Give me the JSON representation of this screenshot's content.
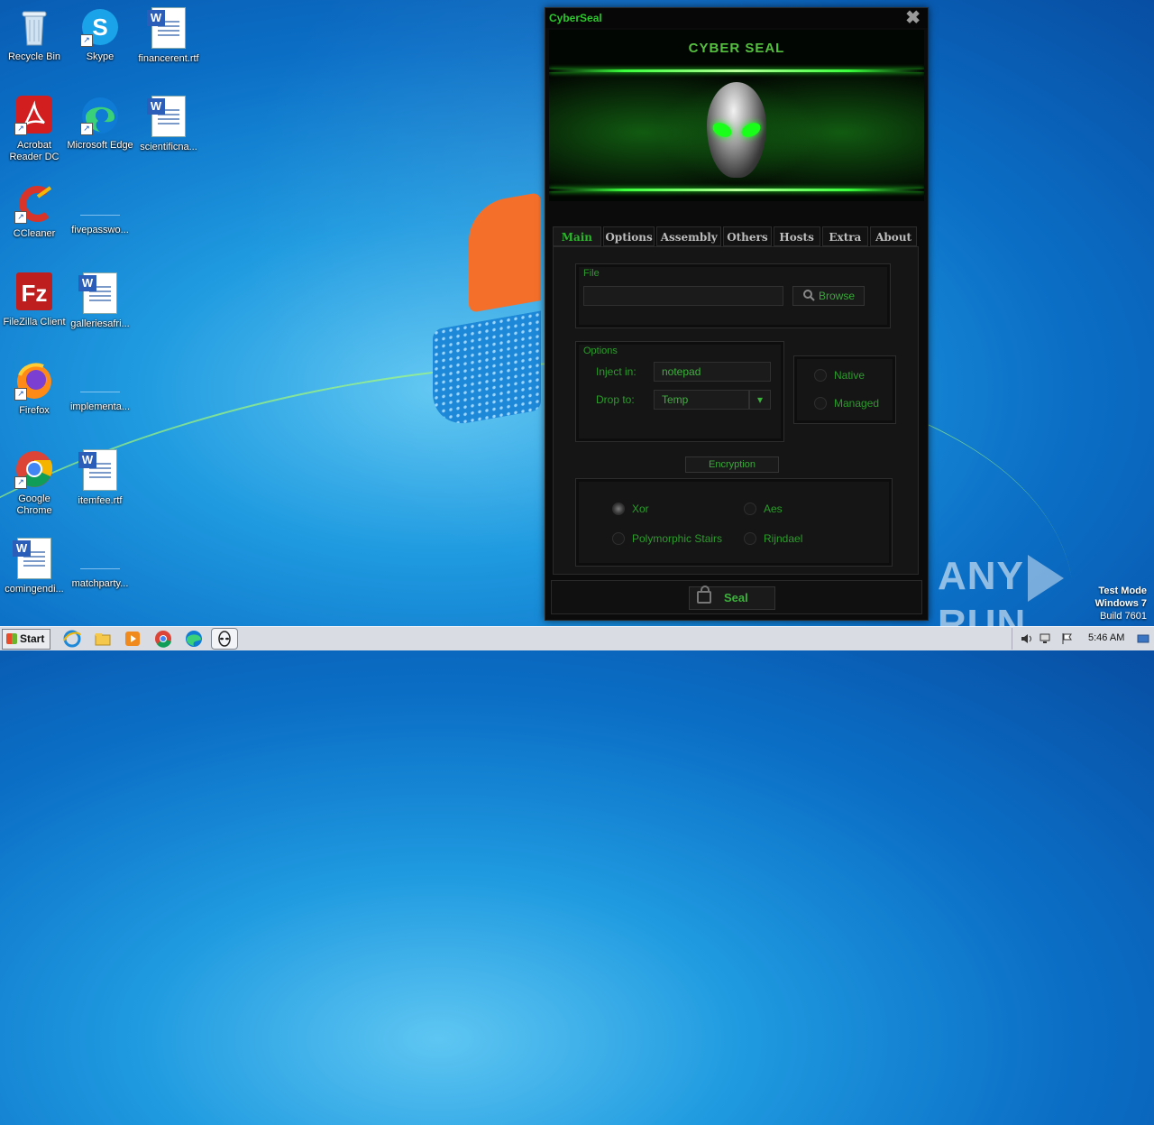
{
  "desktop": {
    "icons": [
      {
        "label": "Recycle Bin"
      },
      {
        "label": "Skype"
      },
      {
        "label": "financerent.rtf"
      },
      {
        "label": "Acrobat Reader DC"
      },
      {
        "label": "Microsoft Edge"
      },
      {
        "label": "scientificna..."
      },
      {
        "label": "CCleaner"
      },
      {
        "label": "fivepasswo..."
      },
      {
        "label": "FileZilla Client"
      },
      {
        "label": "galleriesafri..."
      },
      {
        "label": "Firefox"
      },
      {
        "label": "implementa..."
      },
      {
        "label": "Google Chrome"
      },
      {
        "label": "itemfee.rtf"
      },
      {
        "label": "comingendi..."
      },
      {
        "label": "matchparty..."
      }
    ]
  },
  "window": {
    "title": "CyberSeal",
    "close_glyph": "✖",
    "banner_text": "CYBER SEAL",
    "tabs": [
      "Main",
      "Options",
      "Assembly",
      "Others",
      "Hosts",
      "Extra",
      "About"
    ],
    "active_tab": "Main",
    "file_group": {
      "label": "File",
      "path_value": "",
      "browse_label": "Browse"
    },
    "options_group": {
      "label": "Options",
      "inject_label": "Inject in:",
      "inject_value": "notepad",
      "drop_label": "Drop to:",
      "drop_value": "Temp",
      "dropdown_glyph": "▾"
    },
    "runtime": {
      "native_label": "Native",
      "managed_label": "Managed"
    },
    "encryption": {
      "label": "Encryption",
      "xor_label": "Xor",
      "aes_label": "Aes",
      "stairs_label": "Polymorphic Stairs",
      "rijndael_label": "Rijndael",
      "selected": "Xor"
    },
    "seal_label": "Seal"
  },
  "watermark": {
    "left": "ANY",
    "right": "RUN"
  },
  "test_mode": {
    "line1": "Test Mode",
    "line2": "Windows 7",
    "line3": "Build 7601"
  },
  "taskbar": {
    "start_label": "Start",
    "clock": "5:46 AM"
  }
}
